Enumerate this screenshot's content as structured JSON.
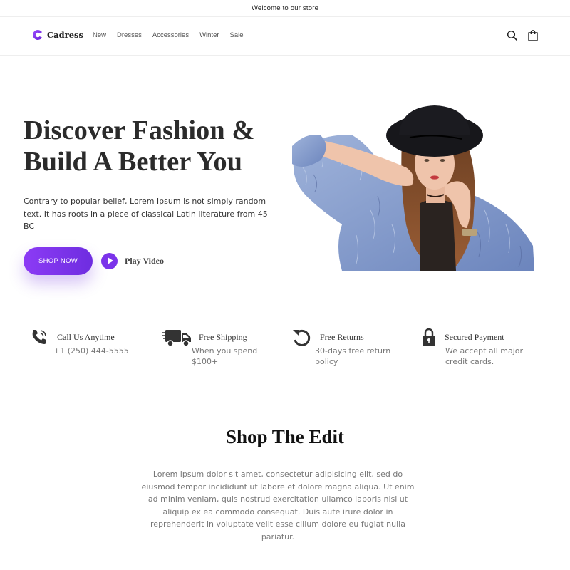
{
  "announcement": "Welcome to our store",
  "brand": {
    "name": "Cadress",
    "accent": "#7b33ea"
  },
  "nav": [
    "New",
    "Dresses",
    "Accessories",
    "Winter",
    "Sale"
  ],
  "header_icons": [
    "search-icon",
    "cart-icon"
  ],
  "hero": {
    "title_line1": "Discover Fashion &",
    "title_line2": "Build A Better You",
    "text": "Contrary to popular belief, Lorem Ipsum is not simply random text. It has roots in a piece of classical Latin literature from 45 BC",
    "cta": "SHOP NOW",
    "play": "Play Video"
  },
  "features": [
    {
      "icon": "phone-icon",
      "title": "Call Us Anytime",
      "text": "+1 (250) 444-5555"
    },
    {
      "icon": "truck-icon",
      "title": "Free Shipping",
      "text": "When you spend $100+"
    },
    {
      "icon": "return-icon",
      "title": "Free Returns",
      "text": "30-days free return policy"
    },
    {
      "icon": "lock-icon",
      "title": "Secured Payment",
      "text": "We accept all major credit cards."
    }
  ],
  "section": {
    "title": "Shop The Edit",
    "text": "Lorem ipsum dolor sit amet, consectetur adipisicing elit, sed do eiusmod tempor incididunt ut labore et dolore magna aliqua. Ut enim ad minim veniam, quis nostrud exercitation ullamco laboris nisi ut aliquip ex ea commodo consequat. Duis aute irure dolor in reprehenderit in voluptate velit esse cillum dolore eu fugiat nulla pariatur."
  }
}
